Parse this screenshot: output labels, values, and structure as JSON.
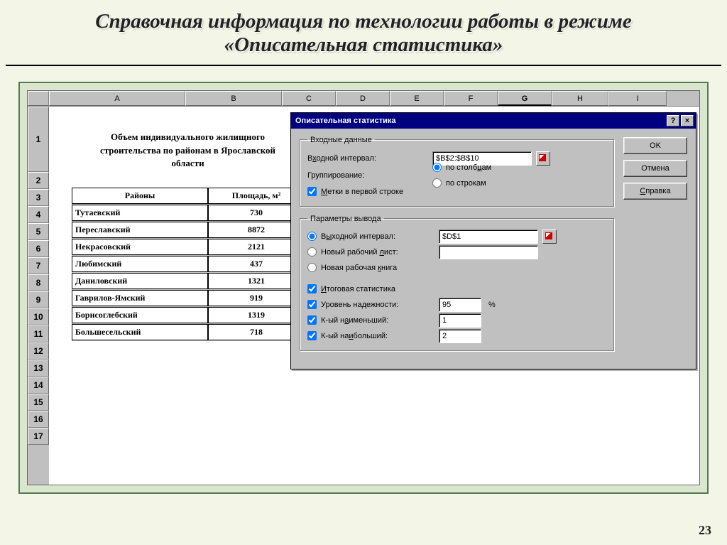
{
  "slide": {
    "title": "Справочная информация по технологии работы в режиме «Описательная статистика»",
    "number": "23"
  },
  "spreadsheet": {
    "columns": [
      "A",
      "B",
      "C",
      "D",
      "E",
      "F",
      "G",
      "H",
      "I"
    ],
    "active_col": "G",
    "row_numbers": [
      "1",
      "2",
      "3",
      "4",
      "5",
      "6",
      "7",
      "8",
      "9",
      "10",
      "11",
      "12",
      "13",
      "14",
      "15",
      "16",
      "17"
    ],
    "title_cell": "Объем индивидуального жилищного строительства по районам в Ярославской области",
    "headers": {
      "a": "Районы",
      "b": "Площадь, м²"
    },
    "rows": [
      {
        "a": "Тутаевский",
        "b": "730"
      },
      {
        "a": "Переславский",
        "b": "8872"
      },
      {
        "a": "Некрасовский",
        "b": "2121"
      },
      {
        "a": "Любимский",
        "b": "437"
      },
      {
        "a": "Даниловский",
        "b": "1321"
      },
      {
        "a": "Гаврилов-Ямский",
        "b": "919"
      },
      {
        "a": "Борисоглебский",
        "b": "1319"
      },
      {
        "a": "Большесельский",
        "b": "718"
      }
    ]
  },
  "dialog": {
    "title": "Описательная статистика",
    "buttons": {
      "ok": "OK",
      "cancel": "Отмена",
      "help": "Справка"
    },
    "input_group": {
      "legend": "Входные данные",
      "range_label": "Входной интервал:",
      "range_value": "$B$2:$B$10",
      "grouping_label": "Группирование:",
      "by_columns": "по столбцам",
      "by_rows": "по строкам",
      "labels_first_row": "Метки в первой строке"
    },
    "output_group": {
      "legend": "Параметры вывода",
      "out_range_label": "Выходной интервал:",
      "out_range_value": "$D$1",
      "new_sheet": "Новый рабочий лист:",
      "new_book": "Новая рабочая книга",
      "summary": "Итоговая статистика",
      "confidence": "Уровень надежности:",
      "confidence_value": "95",
      "kth_smallest": "К-ый наименьший:",
      "kth_smallest_value": "1",
      "kth_largest": "К-ый наибольший:",
      "kth_largest_value": "2"
    }
  }
}
